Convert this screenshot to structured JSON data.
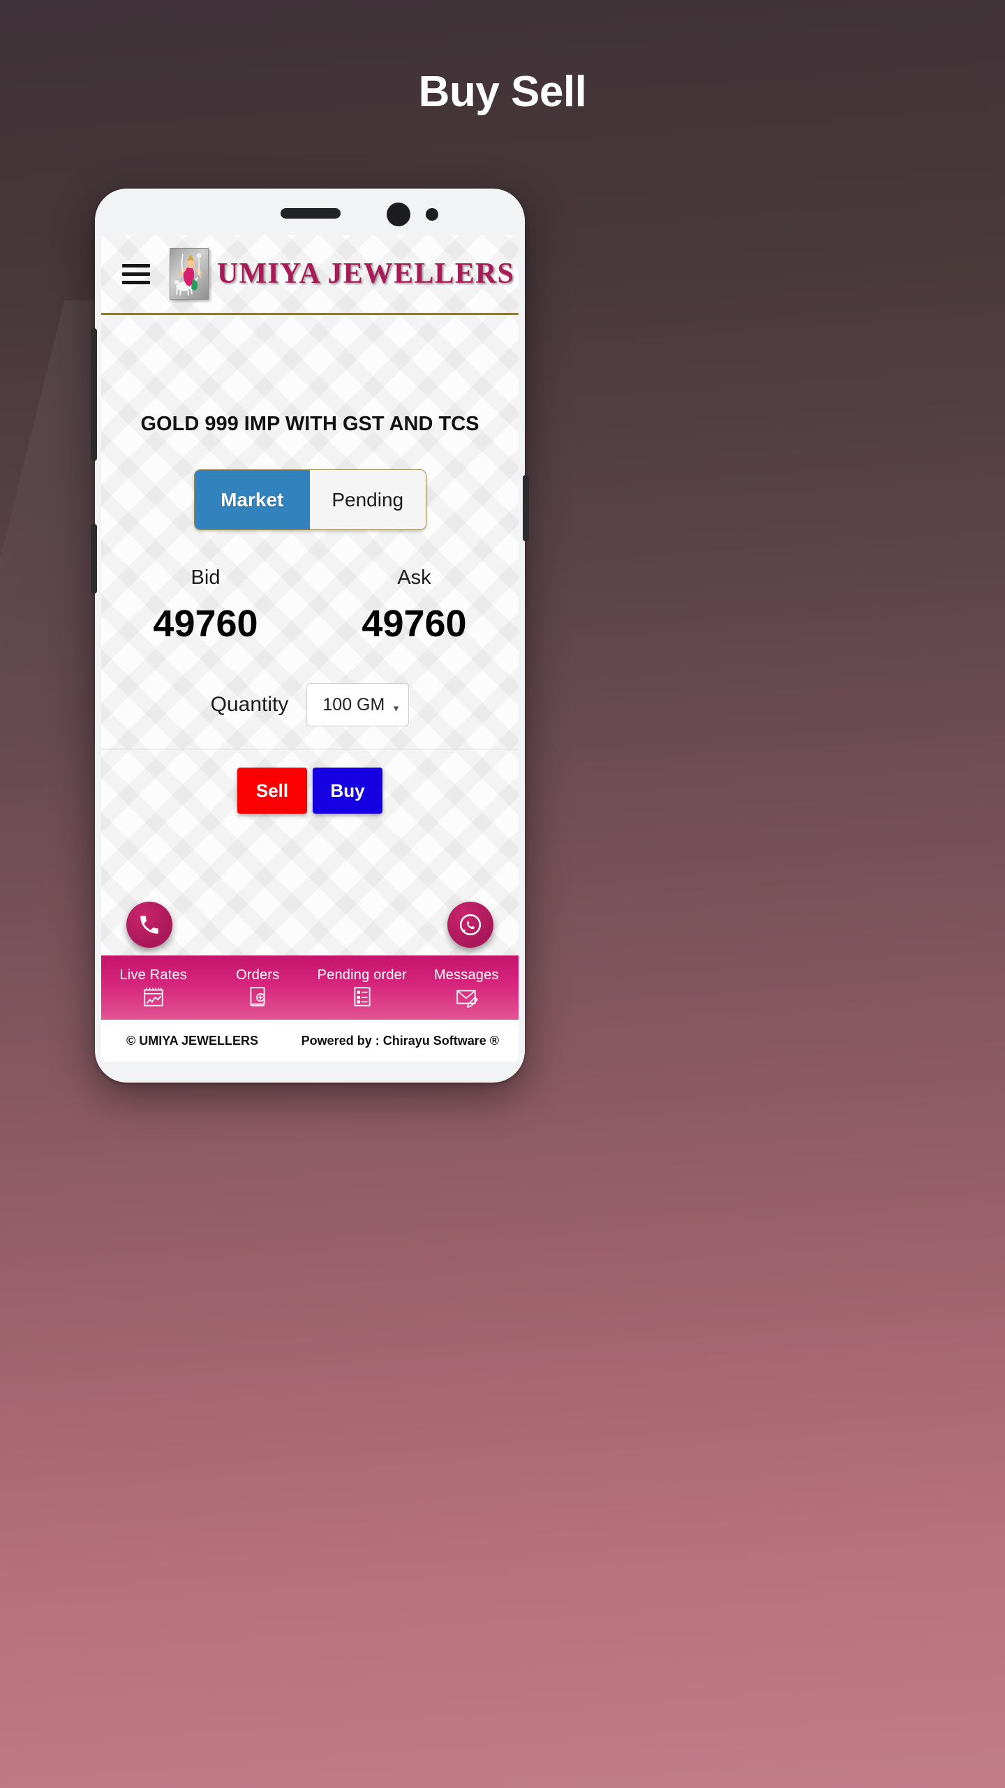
{
  "page": {
    "title": "Buy Sell"
  },
  "app": {
    "brand_name": "UMIYA JEWELLERS",
    "menu_icon": "hamburger-icon",
    "logo_alt": "umiya-mataji-logo"
  },
  "trade": {
    "product_title": "GOLD 999 IMP WITH GST AND TCS",
    "modes": [
      {
        "label": "Market",
        "active": true
      },
      {
        "label": "Pending",
        "active": false
      }
    ],
    "bid": {
      "label": "Bid",
      "value": "49760"
    },
    "ask": {
      "label": "Ask",
      "value": "49760"
    },
    "quantity": {
      "label": "Quantity",
      "value": "100 GM",
      "options": [
        "100 GM"
      ],
      "caret_icon": "chevron-down-icon"
    },
    "actions": {
      "sell_label": "Sell",
      "buy_label": "Buy",
      "sell_color": "#fa0000",
      "buy_color": "#1400e0"
    }
  },
  "contact": {
    "call_icon": "phone-icon",
    "whatsapp_icon": "whatsapp-icon"
  },
  "bottom_nav": [
    {
      "label": "Live Rates",
      "icon": "chart-rates-icon"
    },
    {
      "label": "Orders",
      "icon": "order-book-plus-icon"
    },
    {
      "label": "Pending order",
      "icon": "pending-list-icon"
    },
    {
      "label": "Messages",
      "icon": "envelope-pencil-icon"
    }
  ],
  "footer": {
    "copyright": "© UMIYA JEWELLERS",
    "powered_by": "Powered by : Chirayu Software ®"
  },
  "colors": {
    "brand_crimson": "#a81b57",
    "accent_blue": "#3182bd",
    "nav_pink": "#d6257c",
    "gold_rule": "#8d7a3a"
  }
}
